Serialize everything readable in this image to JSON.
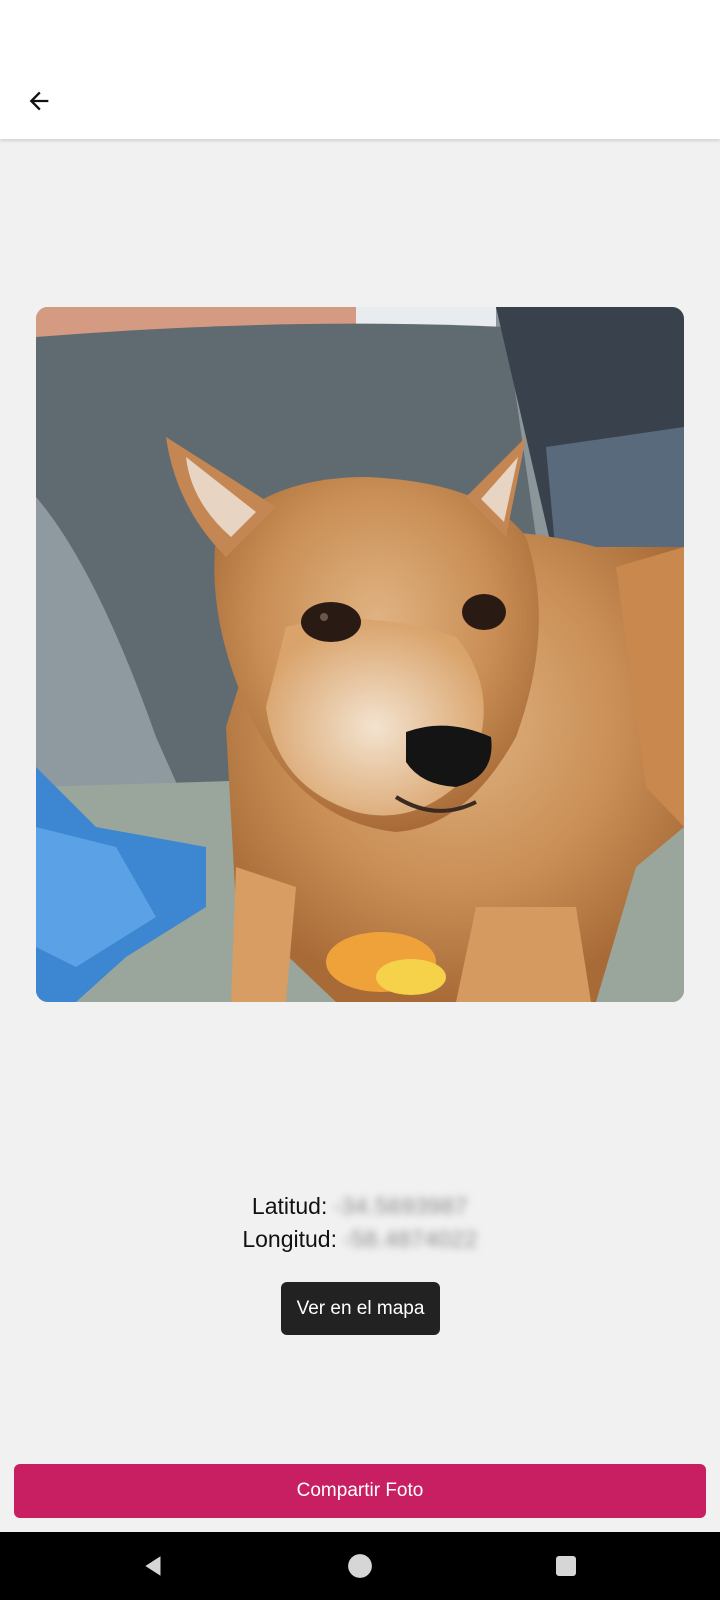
{
  "appbar": {
    "back_icon": "arrow-left-icon"
  },
  "photo": {
    "subject": "dog-photo"
  },
  "location": {
    "lat_label": "Latitud:",
    "lat_value": "-34.5693987",
    "lon_label": "Longitud:",
    "lon_value": "-58.4874022"
  },
  "actions": {
    "map_button": "Ver en el mapa",
    "share_button": "Compartir Foto"
  },
  "colors": {
    "share_button": "#c81f63",
    "map_button": "#222222",
    "background": "#f1f1f1"
  },
  "navbar": {
    "back_icon": "triangle-back-icon",
    "home_icon": "circle-home-icon",
    "recent_icon": "square-recents-icon"
  }
}
